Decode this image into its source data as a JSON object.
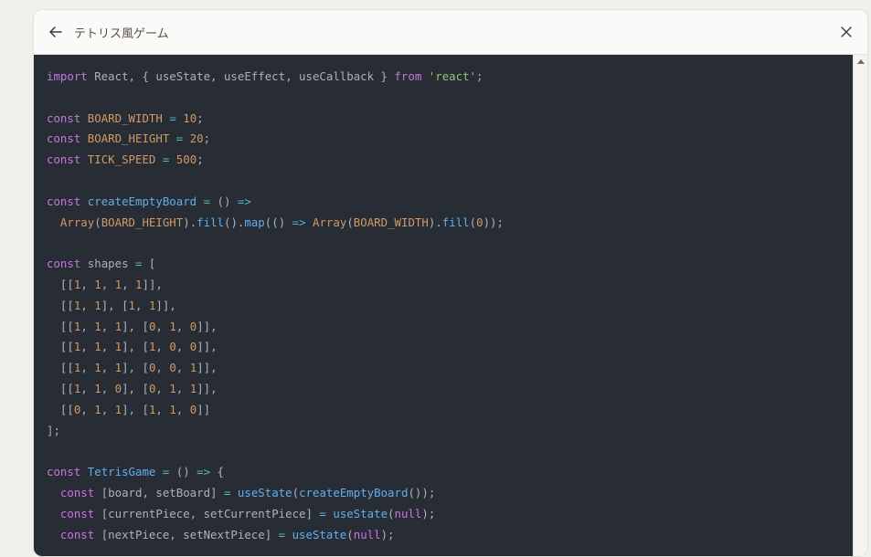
{
  "header": {
    "title": "テトリス風ゲーム",
    "back_icon": "arrow-left-icon",
    "close_icon": "close-icon"
  },
  "colors": {
    "code_background": "#282c34",
    "keyword": "#c678dd",
    "function": "#61afef",
    "string": "#98c379",
    "number": "#d19a66",
    "operator": "#56b6c2",
    "plain": "#abb2bf"
  },
  "code": {
    "lines": [
      [
        [
          "kw",
          "import"
        ],
        [
          "pl",
          " React, { useState, useEffect, useCallback } "
        ],
        [
          "kw",
          "from"
        ],
        [
          "pl",
          " "
        ],
        [
          "str",
          "'react'"
        ],
        [
          "pl",
          ";"
        ]
      ],
      [],
      [
        [
          "kw",
          "const"
        ],
        [
          "pl",
          " "
        ],
        [
          "const-id",
          "BOARD_WIDTH"
        ],
        [
          "pl",
          " "
        ],
        [
          "op",
          "="
        ],
        [
          "pl",
          " "
        ],
        [
          "num",
          "10"
        ],
        [
          "pl",
          ";"
        ]
      ],
      [
        [
          "kw",
          "const"
        ],
        [
          "pl",
          " "
        ],
        [
          "const-id",
          "BOARD_HEIGHT"
        ],
        [
          "pl",
          " "
        ],
        [
          "op",
          "="
        ],
        [
          "pl",
          " "
        ],
        [
          "num",
          "20"
        ],
        [
          "pl",
          ";"
        ]
      ],
      [
        [
          "kw",
          "const"
        ],
        [
          "pl",
          " "
        ],
        [
          "const-id",
          "TICK_SPEED"
        ],
        [
          "pl",
          " "
        ],
        [
          "op",
          "="
        ],
        [
          "pl",
          " "
        ],
        [
          "num",
          "500"
        ],
        [
          "pl",
          ";"
        ]
      ],
      [],
      [
        [
          "kw",
          "const"
        ],
        [
          "pl",
          " "
        ],
        [
          "fn",
          "createEmptyBoard"
        ],
        [
          "pl",
          " "
        ],
        [
          "op",
          "="
        ],
        [
          "pl",
          " () "
        ],
        [
          "op",
          "=>"
        ]
      ],
      [
        [
          "pl",
          "  "
        ],
        [
          "const-id",
          "Array"
        ],
        [
          "pl",
          "("
        ],
        [
          "const-id",
          "BOARD_HEIGHT"
        ],
        [
          "pl",
          ")."
        ],
        [
          "fn",
          "fill"
        ],
        [
          "pl",
          "()."
        ],
        [
          "fn",
          "map"
        ],
        [
          "pl",
          "(() "
        ],
        [
          "op",
          "=>"
        ],
        [
          "pl",
          " "
        ],
        [
          "const-id",
          "Array"
        ],
        [
          "pl",
          "("
        ],
        [
          "const-id",
          "BOARD_WIDTH"
        ],
        [
          "pl",
          ")."
        ],
        [
          "fn",
          "fill"
        ],
        [
          "pl",
          "("
        ],
        [
          "num",
          "0"
        ],
        [
          "pl",
          "));"
        ]
      ],
      [],
      [
        [
          "kw",
          "const"
        ],
        [
          "pl",
          " shapes "
        ],
        [
          "op",
          "="
        ],
        [
          "pl",
          " ["
        ]
      ],
      [
        [
          "pl",
          "  [["
        ],
        [
          "num",
          "1"
        ],
        [
          "pl",
          ", "
        ],
        [
          "num",
          "1"
        ],
        [
          "pl",
          ", "
        ],
        [
          "num",
          "1"
        ],
        [
          "pl",
          ", "
        ],
        [
          "num",
          "1"
        ],
        [
          "pl",
          "]],"
        ]
      ],
      [
        [
          "pl",
          "  [["
        ],
        [
          "num",
          "1"
        ],
        [
          "pl",
          ", "
        ],
        [
          "num",
          "1"
        ],
        [
          "pl",
          "], ["
        ],
        [
          "num",
          "1"
        ],
        [
          "pl",
          ", "
        ],
        [
          "num",
          "1"
        ],
        [
          "pl",
          "]],"
        ]
      ],
      [
        [
          "pl",
          "  [["
        ],
        [
          "num",
          "1"
        ],
        [
          "pl",
          ", "
        ],
        [
          "num",
          "1"
        ],
        [
          "pl",
          ", "
        ],
        [
          "num",
          "1"
        ],
        [
          "pl",
          "], ["
        ],
        [
          "num",
          "0"
        ],
        [
          "pl",
          ", "
        ],
        [
          "num",
          "1"
        ],
        [
          "pl",
          ", "
        ],
        [
          "num",
          "0"
        ],
        [
          "pl",
          "]],"
        ]
      ],
      [
        [
          "pl",
          "  [["
        ],
        [
          "num",
          "1"
        ],
        [
          "pl",
          ", "
        ],
        [
          "num",
          "1"
        ],
        [
          "pl",
          ", "
        ],
        [
          "num",
          "1"
        ],
        [
          "pl",
          "], ["
        ],
        [
          "num",
          "1"
        ],
        [
          "pl",
          ", "
        ],
        [
          "num",
          "0"
        ],
        [
          "pl",
          ", "
        ],
        [
          "num",
          "0"
        ],
        [
          "pl",
          "]],"
        ]
      ],
      [
        [
          "pl",
          "  [["
        ],
        [
          "num",
          "1"
        ],
        [
          "pl",
          ", "
        ],
        [
          "num",
          "1"
        ],
        [
          "pl",
          ", "
        ],
        [
          "num",
          "1"
        ],
        [
          "pl",
          "], ["
        ],
        [
          "num",
          "0"
        ],
        [
          "pl",
          ", "
        ],
        [
          "num",
          "0"
        ],
        [
          "pl",
          ", "
        ],
        [
          "num",
          "1"
        ],
        [
          "pl",
          "]],"
        ]
      ],
      [
        [
          "pl",
          "  [["
        ],
        [
          "num",
          "1"
        ],
        [
          "pl",
          ", "
        ],
        [
          "num",
          "1"
        ],
        [
          "pl",
          ", "
        ],
        [
          "num",
          "0"
        ],
        [
          "pl",
          "], ["
        ],
        [
          "num",
          "0"
        ],
        [
          "pl",
          ", "
        ],
        [
          "num",
          "1"
        ],
        [
          "pl",
          ", "
        ],
        [
          "num",
          "1"
        ],
        [
          "pl",
          "]],"
        ]
      ],
      [
        [
          "pl",
          "  [["
        ],
        [
          "num",
          "0"
        ],
        [
          "pl",
          ", "
        ],
        [
          "num",
          "1"
        ],
        [
          "pl",
          ", "
        ],
        [
          "num",
          "1"
        ],
        [
          "pl",
          "], ["
        ],
        [
          "num",
          "1"
        ],
        [
          "pl",
          ", "
        ],
        [
          "num",
          "1"
        ],
        [
          "pl",
          ", "
        ],
        [
          "num",
          "0"
        ],
        [
          "pl",
          "]]"
        ]
      ],
      [
        [
          "pl",
          "];"
        ]
      ],
      [],
      [
        [
          "kw",
          "const"
        ],
        [
          "pl",
          " "
        ],
        [
          "fn",
          "TetrisGame"
        ],
        [
          "pl",
          " "
        ],
        [
          "op",
          "="
        ],
        [
          "pl",
          " () "
        ],
        [
          "op",
          "=>"
        ],
        [
          "pl",
          " {"
        ]
      ],
      [
        [
          "pl",
          "  "
        ],
        [
          "kw",
          "const"
        ],
        [
          "pl",
          " [board, setBoard] "
        ],
        [
          "op",
          "="
        ],
        [
          "pl",
          " "
        ],
        [
          "fn",
          "useState"
        ],
        [
          "pl",
          "("
        ],
        [
          "fn",
          "createEmptyBoard"
        ],
        [
          "pl",
          "());"
        ]
      ],
      [
        [
          "pl",
          "  "
        ],
        [
          "kw",
          "const"
        ],
        [
          "pl",
          " [currentPiece, setCurrentPiece] "
        ],
        [
          "op",
          "="
        ],
        [
          "pl",
          " "
        ],
        [
          "fn",
          "useState"
        ],
        [
          "pl",
          "("
        ],
        [
          "kw",
          "null"
        ],
        [
          "pl",
          ");"
        ]
      ],
      [
        [
          "pl",
          "  "
        ],
        [
          "kw",
          "const"
        ],
        [
          "pl",
          " [nextPiece, setNextPiece] "
        ],
        [
          "op",
          "="
        ],
        [
          "pl",
          " "
        ],
        [
          "fn",
          "useState"
        ],
        [
          "pl",
          "("
        ],
        [
          "kw",
          "null"
        ],
        [
          "pl",
          ");"
        ]
      ]
    ]
  }
}
